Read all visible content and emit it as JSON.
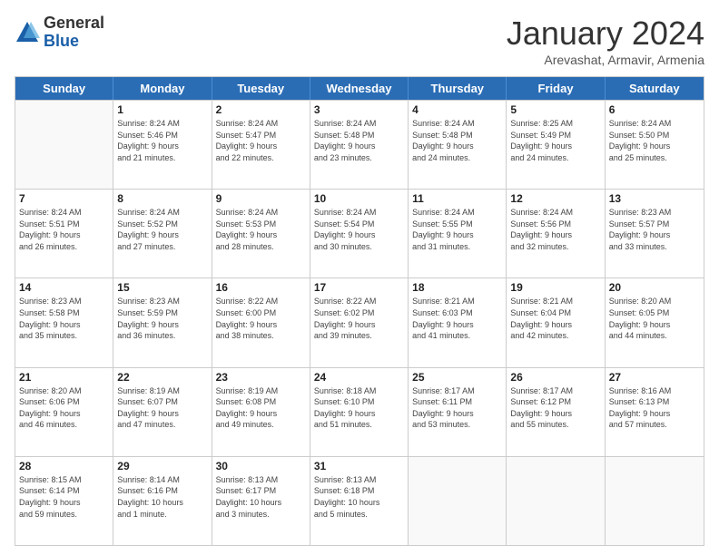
{
  "logo": {
    "general": "General",
    "blue": "Blue"
  },
  "header": {
    "title": "January 2024",
    "subtitle": "Arevashat, Armavir, Armenia"
  },
  "calendar": {
    "days": [
      "Sunday",
      "Monday",
      "Tuesday",
      "Wednesday",
      "Thursday",
      "Friday",
      "Saturday"
    ],
    "rows": [
      [
        {
          "day": "",
          "lines": []
        },
        {
          "day": "1",
          "lines": [
            "Sunrise: 8:24 AM",
            "Sunset: 5:46 PM",
            "Daylight: 9 hours",
            "and 21 minutes."
          ]
        },
        {
          "day": "2",
          "lines": [
            "Sunrise: 8:24 AM",
            "Sunset: 5:47 PM",
            "Daylight: 9 hours",
            "and 22 minutes."
          ]
        },
        {
          "day": "3",
          "lines": [
            "Sunrise: 8:24 AM",
            "Sunset: 5:48 PM",
            "Daylight: 9 hours",
            "and 23 minutes."
          ]
        },
        {
          "day": "4",
          "lines": [
            "Sunrise: 8:24 AM",
            "Sunset: 5:48 PM",
            "Daylight: 9 hours",
            "and 24 minutes."
          ]
        },
        {
          "day": "5",
          "lines": [
            "Sunrise: 8:25 AM",
            "Sunset: 5:49 PM",
            "Daylight: 9 hours",
            "and 24 minutes."
          ]
        },
        {
          "day": "6",
          "lines": [
            "Sunrise: 8:24 AM",
            "Sunset: 5:50 PM",
            "Daylight: 9 hours",
            "and 25 minutes."
          ]
        }
      ],
      [
        {
          "day": "7",
          "lines": [
            "Sunrise: 8:24 AM",
            "Sunset: 5:51 PM",
            "Daylight: 9 hours",
            "and 26 minutes."
          ]
        },
        {
          "day": "8",
          "lines": [
            "Sunrise: 8:24 AM",
            "Sunset: 5:52 PM",
            "Daylight: 9 hours",
            "and 27 minutes."
          ]
        },
        {
          "day": "9",
          "lines": [
            "Sunrise: 8:24 AM",
            "Sunset: 5:53 PM",
            "Daylight: 9 hours",
            "and 28 minutes."
          ]
        },
        {
          "day": "10",
          "lines": [
            "Sunrise: 8:24 AM",
            "Sunset: 5:54 PM",
            "Daylight: 9 hours",
            "and 30 minutes."
          ]
        },
        {
          "day": "11",
          "lines": [
            "Sunrise: 8:24 AM",
            "Sunset: 5:55 PM",
            "Daylight: 9 hours",
            "and 31 minutes."
          ]
        },
        {
          "day": "12",
          "lines": [
            "Sunrise: 8:24 AM",
            "Sunset: 5:56 PM",
            "Daylight: 9 hours",
            "and 32 minutes."
          ]
        },
        {
          "day": "13",
          "lines": [
            "Sunrise: 8:23 AM",
            "Sunset: 5:57 PM",
            "Daylight: 9 hours",
            "and 33 minutes."
          ]
        }
      ],
      [
        {
          "day": "14",
          "lines": [
            "Sunrise: 8:23 AM",
            "Sunset: 5:58 PM",
            "Daylight: 9 hours",
            "and 35 minutes."
          ]
        },
        {
          "day": "15",
          "lines": [
            "Sunrise: 8:23 AM",
            "Sunset: 5:59 PM",
            "Daylight: 9 hours",
            "and 36 minutes."
          ]
        },
        {
          "day": "16",
          "lines": [
            "Sunrise: 8:22 AM",
            "Sunset: 6:00 PM",
            "Daylight: 9 hours",
            "and 38 minutes."
          ]
        },
        {
          "day": "17",
          "lines": [
            "Sunrise: 8:22 AM",
            "Sunset: 6:02 PM",
            "Daylight: 9 hours",
            "and 39 minutes."
          ]
        },
        {
          "day": "18",
          "lines": [
            "Sunrise: 8:21 AM",
            "Sunset: 6:03 PM",
            "Daylight: 9 hours",
            "and 41 minutes."
          ]
        },
        {
          "day": "19",
          "lines": [
            "Sunrise: 8:21 AM",
            "Sunset: 6:04 PM",
            "Daylight: 9 hours",
            "and 42 minutes."
          ]
        },
        {
          "day": "20",
          "lines": [
            "Sunrise: 8:20 AM",
            "Sunset: 6:05 PM",
            "Daylight: 9 hours",
            "and 44 minutes."
          ]
        }
      ],
      [
        {
          "day": "21",
          "lines": [
            "Sunrise: 8:20 AM",
            "Sunset: 6:06 PM",
            "Daylight: 9 hours",
            "and 46 minutes."
          ]
        },
        {
          "day": "22",
          "lines": [
            "Sunrise: 8:19 AM",
            "Sunset: 6:07 PM",
            "Daylight: 9 hours",
            "and 47 minutes."
          ]
        },
        {
          "day": "23",
          "lines": [
            "Sunrise: 8:19 AM",
            "Sunset: 6:08 PM",
            "Daylight: 9 hours",
            "and 49 minutes."
          ]
        },
        {
          "day": "24",
          "lines": [
            "Sunrise: 8:18 AM",
            "Sunset: 6:10 PM",
            "Daylight: 9 hours",
            "and 51 minutes."
          ]
        },
        {
          "day": "25",
          "lines": [
            "Sunrise: 8:17 AM",
            "Sunset: 6:11 PM",
            "Daylight: 9 hours",
            "and 53 minutes."
          ]
        },
        {
          "day": "26",
          "lines": [
            "Sunrise: 8:17 AM",
            "Sunset: 6:12 PM",
            "Daylight: 9 hours",
            "and 55 minutes."
          ]
        },
        {
          "day": "27",
          "lines": [
            "Sunrise: 8:16 AM",
            "Sunset: 6:13 PM",
            "Daylight: 9 hours",
            "and 57 minutes."
          ]
        }
      ],
      [
        {
          "day": "28",
          "lines": [
            "Sunrise: 8:15 AM",
            "Sunset: 6:14 PM",
            "Daylight: 9 hours",
            "and 59 minutes."
          ]
        },
        {
          "day": "29",
          "lines": [
            "Sunrise: 8:14 AM",
            "Sunset: 6:16 PM",
            "Daylight: 10 hours",
            "and 1 minute."
          ]
        },
        {
          "day": "30",
          "lines": [
            "Sunrise: 8:13 AM",
            "Sunset: 6:17 PM",
            "Daylight: 10 hours",
            "and 3 minutes."
          ]
        },
        {
          "day": "31",
          "lines": [
            "Sunrise: 8:13 AM",
            "Sunset: 6:18 PM",
            "Daylight: 10 hours",
            "and 5 minutes."
          ]
        },
        {
          "day": "",
          "lines": []
        },
        {
          "day": "",
          "lines": []
        },
        {
          "day": "",
          "lines": []
        }
      ]
    ]
  }
}
